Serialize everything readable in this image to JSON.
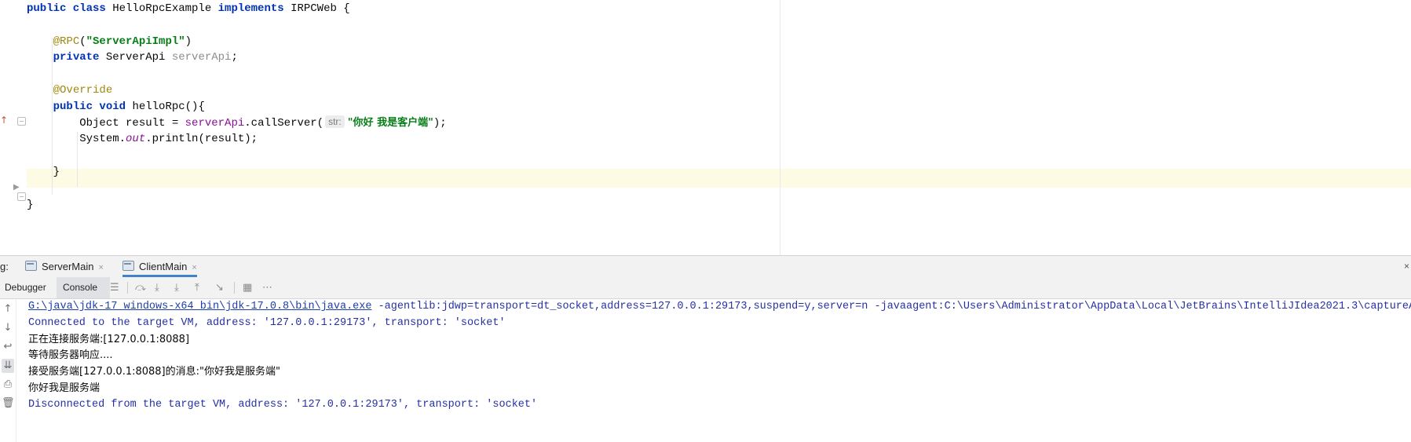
{
  "editor": {
    "lines": [
      {
        "segments": [
          {
            "cls": "kw",
            "text": "public class "
          },
          {
            "cls": "",
            "text": "HelloRpcExample "
          },
          {
            "cls": "kw",
            "text": "implements "
          },
          {
            "cls": "",
            "text": "IRPCWeb {"
          }
        ]
      },
      {
        "segments": []
      },
      {
        "segments": [
          {
            "cls": "",
            "text": "    "
          },
          {
            "cls": "ann",
            "text": "@RPC"
          },
          {
            "cls": "",
            "text": "("
          },
          {
            "cls": "str",
            "text": "\"ServerApiImpl\""
          },
          {
            "cls": "",
            "text": ")"
          }
        ]
      },
      {
        "segments": [
          {
            "cls": "",
            "text": "    "
          },
          {
            "cls": "kw",
            "text": "private "
          },
          {
            "cls": "",
            "text": "ServerApi "
          },
          {
            "cls": "fld-unused",
            "text": "serverApi"
          },
          {
            "cls": "",
            "text": ";"
          }
        ]
      },
      {
        "segments": []
      },
      {
        "segments": [
          {
            "cls": "",
            "text": "    "
          },
          {
            "cls": "ann",
            "text": "@Override"
          }
        ]
      },
      {
        "segments": [
          {
            "cls": "",
            "text": "    "
          },
          {
            "cls": "kw",
            "text": "public void "
          },
          {
            "cls": "",
            "text": "helloRpc(){"
          }
        ]
      },
      {
        "segments": [
          {
            "cls": "",
            "text": "        Object result = "
          },
          {
            "cls": "fld",
            "text": "serverApi"
          },
          {
            "cls": "",
            "text": ".callServer("
          },
          {
            "cls": "hint",
            "text": "str:"
          },
          {
            "cls": "str cjk",
            "text": "\"你好 我是客户端\""
          },
          {
            "cls": "",
            "text": ");"
          }
        ]
      },
      {
        "segments": [
          {
            "cls": "",
            "text": "        System."
          },
          {
            "cls": "fld-static",
            "text": "out"
          },
          {
            "cls": "",
            "text": ".println(result);"
          }
        ]
      },
      {
        "segments": []
      },
      {
        "segments": [
          {
            "cls": "",
            "text": "    }"
          }
        ]
      },
      {
        "segments": []
      },
      {
        "segments": [
          {
            "cls": "",
            "text": "}"
          }
        ]
      }
    ]
  },
  "run_panel": {
    "prefix": "g:",
    "tabs": [
      {
        "label": "ServerMain",
        "close": "×",
        "active": false
      },
      {
        "label": "ClientMain",
        "close": "×",
        "active": true
      }
    ],
    "far_close": "×",
    "subtabs": [
      {
        "label": "Debugger",
        "active": false
      },
      {
        "label": "Console",
        "active": true
      }
    ],
    "toolbar_icons": [
      "list-icon",
      "step-over-icon",
      "step-into-icon",
      "force-step-into-icon",
      "step-out-icon",
      "run-to-cursor-icon",
      "evaluate-icon",
      "trace-icon"
    ],
    "side_icons": [
      "up-arrow-icon",
      "down-arrow-icon",
      "soft-wrap-icon",
      "scroll-to-end-icon",
      "print-icon",
      "trash-icon"
    ]
  },
  "console": {
    "lines": [
      {
        "segments": [
          {
            "cls": "con-link",
            "text": "G:\\java\\jdk-17_windows-x64_bin\\jdk-17.0.8\\bin\\java.exe"
          },
          {
            "cls": "con-blue",
            "text": " -agentlib:jdwp=transport=dt_socket,address=127.0.0.1:29173,suspend=y,server=n -javaagent:C:\\Users\\Administrator\\AppData\\Local\\JetBrains\\IntelliJIdea2021.3\\captureAge"
          }
        ]
      },
      {
        "segments": [
          {
            "cls": "con-blue",
            "text": "Connected to the target VM, address: '127.0.0.1:29173', transport: 'socket'"
          }
        ]
      },
      {
        "segments": [
          {
            "cls": "cjk",
            "text": "正在连接服务端:[127.0.0.1:8088]"
          }
        ]
      },
      {
        "segments": [
          {
            "cls": "cjk",
            "text": "等待服务器响应...."
          }
        ]
      },
      {
        "segments": [
          {
            "cls": "cjk",
            "text": "接受服务端[127.0.0.1:8088]的消息:\"你好我是服务端\""
          }
        ]
      },
      {
        "segments": [
          {
            "cls": "cjk",
            "text": "你好我是服务端"
          }
        ]
      },
      {
        "segments": [
          {
            "cls": "con-blue",
            "text": "Disconnected from the target VM, address: '127.0.0.1:29173', transport: 'socket'"
          }
        ]
      }
    ]
  }
}
